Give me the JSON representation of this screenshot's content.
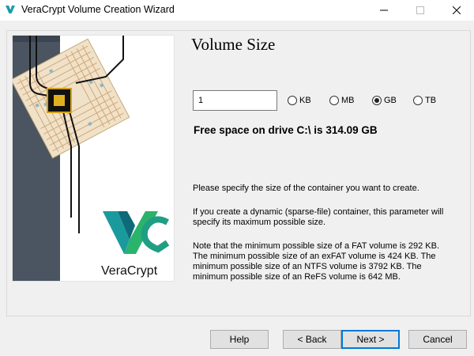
{
  "window": {
    "title": "VeraCrypt Volume Creation Wizard",
    "icon": "veracrypt-icon",
    "controls": [
      "minimize-icon",
      "maximize-icon",
      "close-icon"
    ]
  },
  "graphic": {
    "brand": "VeraCrypt"
  },
  "page": {
    "title": "Volume Size"
  },
  "size": {
    "value": "1",
    "units": [
      {
        "label": "KB",
        "selected": false
      },
      {
        "label": "MB",
        "selected": false
      },
      {
        "label": "GB",
        "selected": true
      },
      {
        "label": "TB",
        "selected": false
      }
    ]
  },
  "free_space": "Free space on drive C:\\ is 314.09 GB",
  "info": {
    "p1": "Please specify the size of the container you want to create.",
    "p2": "If you create a dynamic (sparse-file) container, this parameter will specify its maximum possible size.",
    "p3": "Note that the minimum possible size of a FAT volume is 292 KB. The minimum possible size of an exFAT volume is 424 KB. The minimum possible size of an NTFS volume is 3792 KB. The minimum possible size of an ReFS volume is 642 MB."
  },
  "buttons": {
    "help": "Help",
    "back": "< Back",
    "next": "Next >",
    "cancel": "Cancel"
  }
}
